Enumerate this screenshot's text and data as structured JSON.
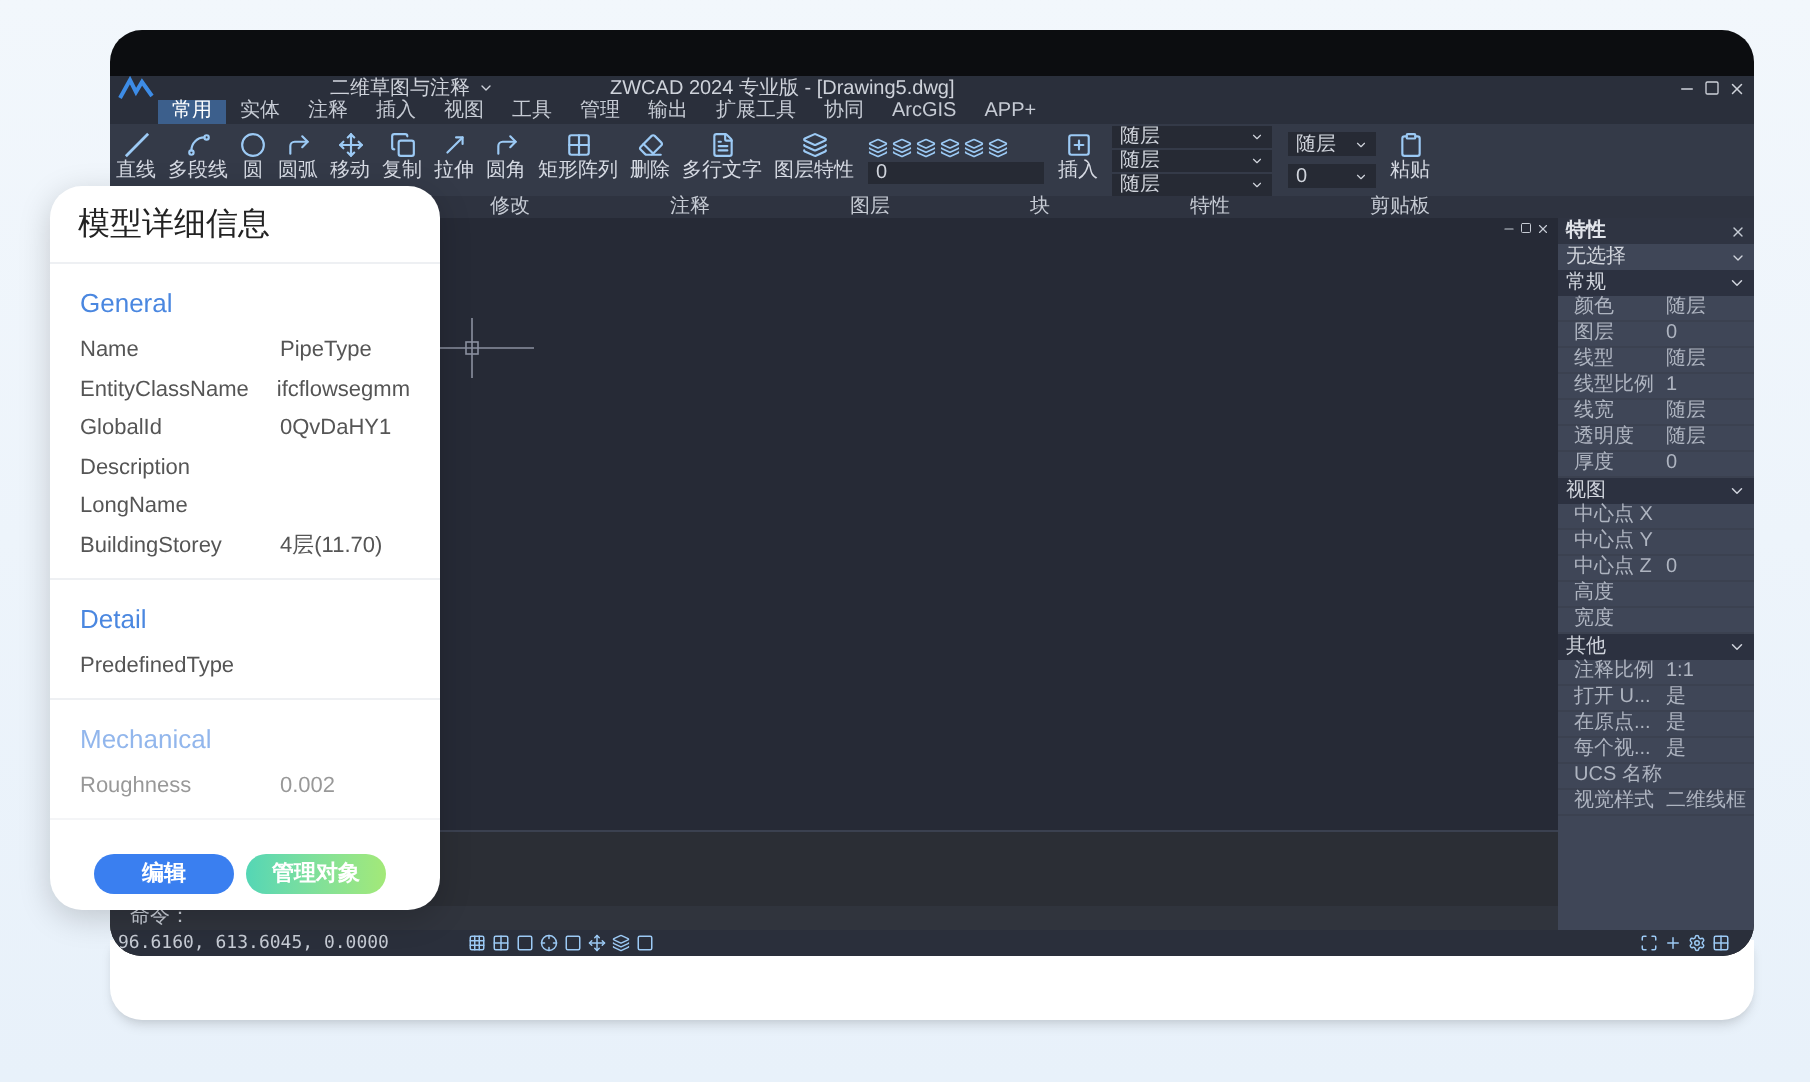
{
  "window": {
    "title": "ZWCAD 2024 专业版 - [Drawing5.dwg]",
    "workspace": "二维草图与注释"
  },
  "menu_tabs": [
    {
      "label": "常用",
      "selected": true
    },
    {
      "label": "实体",
      "selected": false
    },
    {
      "label": "注释",
      "selected": false
    },
    {
      "label": "插入",
      "selected": false
    },
    {
      "label": "视图",
      "selected": false
    },
    {
      "label": "工具",
      "selected": false
    },
    {
      "label": "管理",
      "selected": false
    },
    {
      "label": "输出",
      "selected": false
    },
    {
      "label": "扩展工具",
      "selected": false
    },
    {
      "label": "协同",
      "selected": false
    },
    {
      "label": "ArcGIS",
      "selected": false
    },
    {
      "label": "APP+",
      "selected": false
    }
  ],
  "ribbon": {
    "tools": [
      {
        "label": "直线"
      },
      {
        "label": "多段线"
      },
      {
        "label": "圆"
      },
      {
        "label": "圆弧"
      },
      {
        "label": "移动"
      },
      {
        "label": "复制"
      },
      {
        "label": "拉伸"
      },
      {
        "label": "圆角"
      },
      {
        "label": "矩形阵列"
      },
      {
        "label": "删除"
      },
      {
        "label": "多行文字"
      },
      {
        "label": "图层特性"
      },
      {
        "label": "插入"
      },
      {
        "label": "粘贴"
      }
    ],
    "layer_value": "0",
    "property_fields": [
      "随层",
      "随层",
      "随层",
      "随层",
      "0"
    ],
    "groups": [
      "修改",
      "注释",
      "图层",
      "块",
      "特性",
      "剪贴板"
    ]
  },
  "properties": {
    "title": "特性",
    "selection": "无选择",
    "sections": [
      {
        "title": "常规",
        "expanded": true,
        "rows": [
          {
            "label": "颜色",
            "value": "随层"
          },
          {
            "label": "图层",
            "value": "0"
          },
          {
            "label": "线型",
            "value": "随层"
          },
          {
            "label": "线型比例",
            "value": "1"
          },
          {
            "label": "线宽",
            "value": "随层"
          },
          {
            "label": "透明度",
            "value": "随层"
          },
          {
            "label": "厚度",
            "value": "0"
          }
        ]
      },
      {
        "title": "视图",
        "expanded": true,
        "rows": [
          {
            "label": "中心点 X"
          },
          {
            "label": "中心点 Y"
          },
          {
            "label": "中心点 Z",
            "value": "0"
          },
          {
            "label": "高度"
          },
          {
            "label": "宽度"
          }
        ]
      },
      {
        "title": "其他",
        "expanded": true,
        "rows": [
          {
            "label": "注释比例",
            "value": "1:1"
          },
          {
            "label": "打开 U...",
            "value": "是"
          },
          {
            "label": "在原点...",
            "value": "是"
          },
          {
            "label": "每个视...",
            "value": "是"
          },
          {
            "label": "UCS 名称"
          },
          {
            "label": "视觉样式",
            "value": "二维线框"
          }
        ]
      }
    ]
  },
  "command": {
    "prompt": "命令："
  },
  "status_bar": {
    "coordinates": "96.6160, 613.6045, 0.0000"
  },
  "detail_card": {
    "title": "模型详细信息",
    "sections": [
      {
        "title": "General",
        "rows": [
          {
            "name": "Name",
            "value": "PipeType"
          },
          {
            "name": "EntityClassName",
            "value": "ifcflowsegmm"
          },
          {
            "name": "GlobalId",
            "value": "0QvDaHY1"
          },
          {
            "name": "Description"
          },
          {
            "name": "LongName"
          },
          {
            "name": "BuildingStorey",
            "value": "4层(11.70)"
          }
        ]
      },
      {
        "title": "Detail",
        "rows": [
          {
            "name": "PredefinedType"
          }
        ]
      },
      {
        "title": "Mechanical",
        "faded": true,
        "rows": [
          {
            "name": "Roughness",
            "value": "0.002"
          }
        ]
      }
    ],
    "buttons": [
      {
        "label": "编辑",
        "kind": "primary"
      },
      {
        "label": "管理对象",
        "kind": "secondary"
      }
    ]
  }
}
